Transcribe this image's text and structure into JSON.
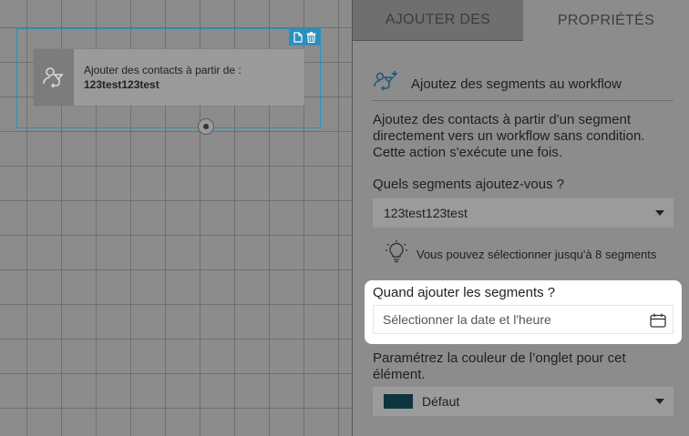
{
  "canvas": {
    "node": {
      "line1": "Ajouter des contacts à partir de :",
      "line2": "123test123test",
      "icon": "add-contacts-icon"
    },
    "actions": {
      "copy_icon": "copy-icon",
      "delete_icon": "trash-icon"
    }
  },
  "panel": {
    "tabs": [
      {
        "label": "AJOUTER DES"
      },
      {
        "label": "PROPRIÉTÉS"
      }
    ],
    "section_title": "Ajoutez des segments au workflow",
    "section_icon": "segment-workflow-icon",
    "description": "Ajoutez des contacts à partir d'un segment directement vers un workflow sans condition. Cette action s'exécute une fois.",
    "segments_question": "Quels segments ajoutez-vous ?",
    "segments_selected": "123test123test",
    "hint": "Vous pouvez sélectionner jusqu'à 8 segments",
    "hint_icon": "lightbulb-icon",
    "when_label": "Quand ajouter les segments ?",
    "date_placeholder": "Sélectionner la date et l'heure",
    "calendar_icon": "calendar-icon",
    "color_label": "Paramétrez la couleur de l’onglet pour cet élément.",
    "color_selected": "Défaut",
    "color_swatch": "#0e3440"
  }
}
